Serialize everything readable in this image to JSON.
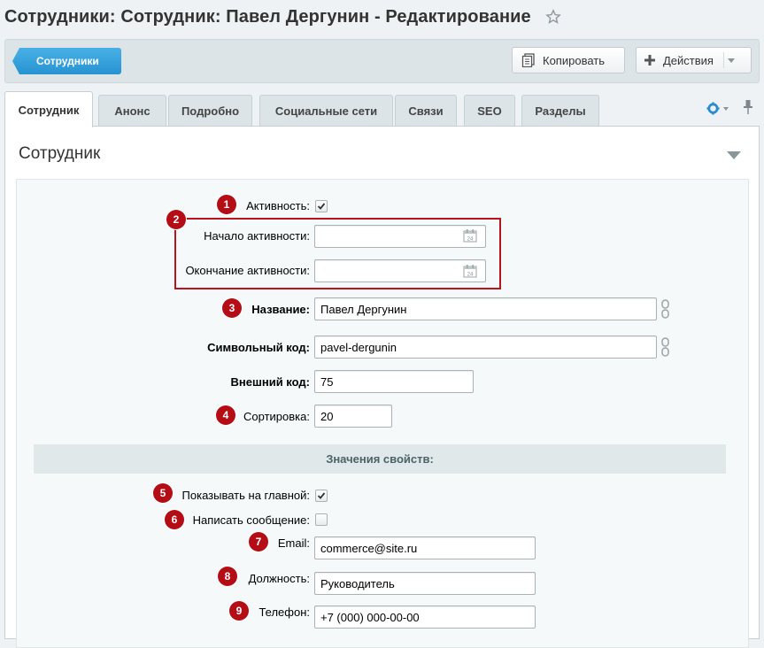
{
  "page": {
    "title": "Сотрудники: Сотрудник: Павел Дергунин - Редактирование"
  },
  "toolbar": {
    "back_label": "Сотрудники",
    "copy_label": "Копировать",
    "actions_label": "Действия"
  },
  "tabs": [
    {
      "label": "Сотрудник",
      "active": true
    },
    {
      "label": "Анонс"
    },
    {
      "label": "Подробно"
    },
    {
      "label": "Социальные сети"
    },
    {
      "label": "Связи"
    },
    {
      "label": "SEO"
    },
    {
      "label": "Разделы"
    }
  ],
  "section": {
    "title": "Сотрудник"
  },
  "form": {
    "active": {
      "label": "Активность:",
      "checked": true,
      "badge": "1"
    },
    "dates_badge": "2",
    "start": {
      "label": "Начало активности:",
      "value": ""
    },
    "end": {
      "label": "Окончание активности:",
      "value": ""
    },
    "name": {
      "label": "Название:",
      "value": "Павел Дергунин",
      "badge": "3"
    },
    "code": {
      "label": "Символьный код:",
      "value": "pavel-dergunin"
    },
    "xml_id": {
      "label": "Внешний код:",
      "value": "75"
    },
    "sort": {
      "label": "Сортировка:",
      "value": "20",
      "badge": "4"
    }
  },
  "properties": {
    "header": "Значения свойств:",
    "show_main": {
      "label": "Показывать на главной:",
      "checked": true,
      "badge": "5"
    },
    "write_msg": {
      "label": "Написать сообщение:",
      "checked": false,
      "badge": "6"
    },
    "email": {
      "label": "Email:",
      "value": "commerce@site.ru",
      "badge": "7"
    },
    "position": {
      "label": "Должность:",
      "value": "Руководитель",
      "badge": "8"
    },
    "phone": {
      "label": "Телефон:",
      "value": "+7 (000) 000-00-00",
      "badge": "9"
    }
  },
  "colors": {
    "accent": "#2693d1",
    "badge": "#b40d15"
  },
  "icons": [
    "star-icon",
    "copy-icon",
    "plus-icon",
    "gear-icon",
    "pin-icon",
    "calendar-icon",
    "chain-icon",
    "collapse-icon"
  ]
}
